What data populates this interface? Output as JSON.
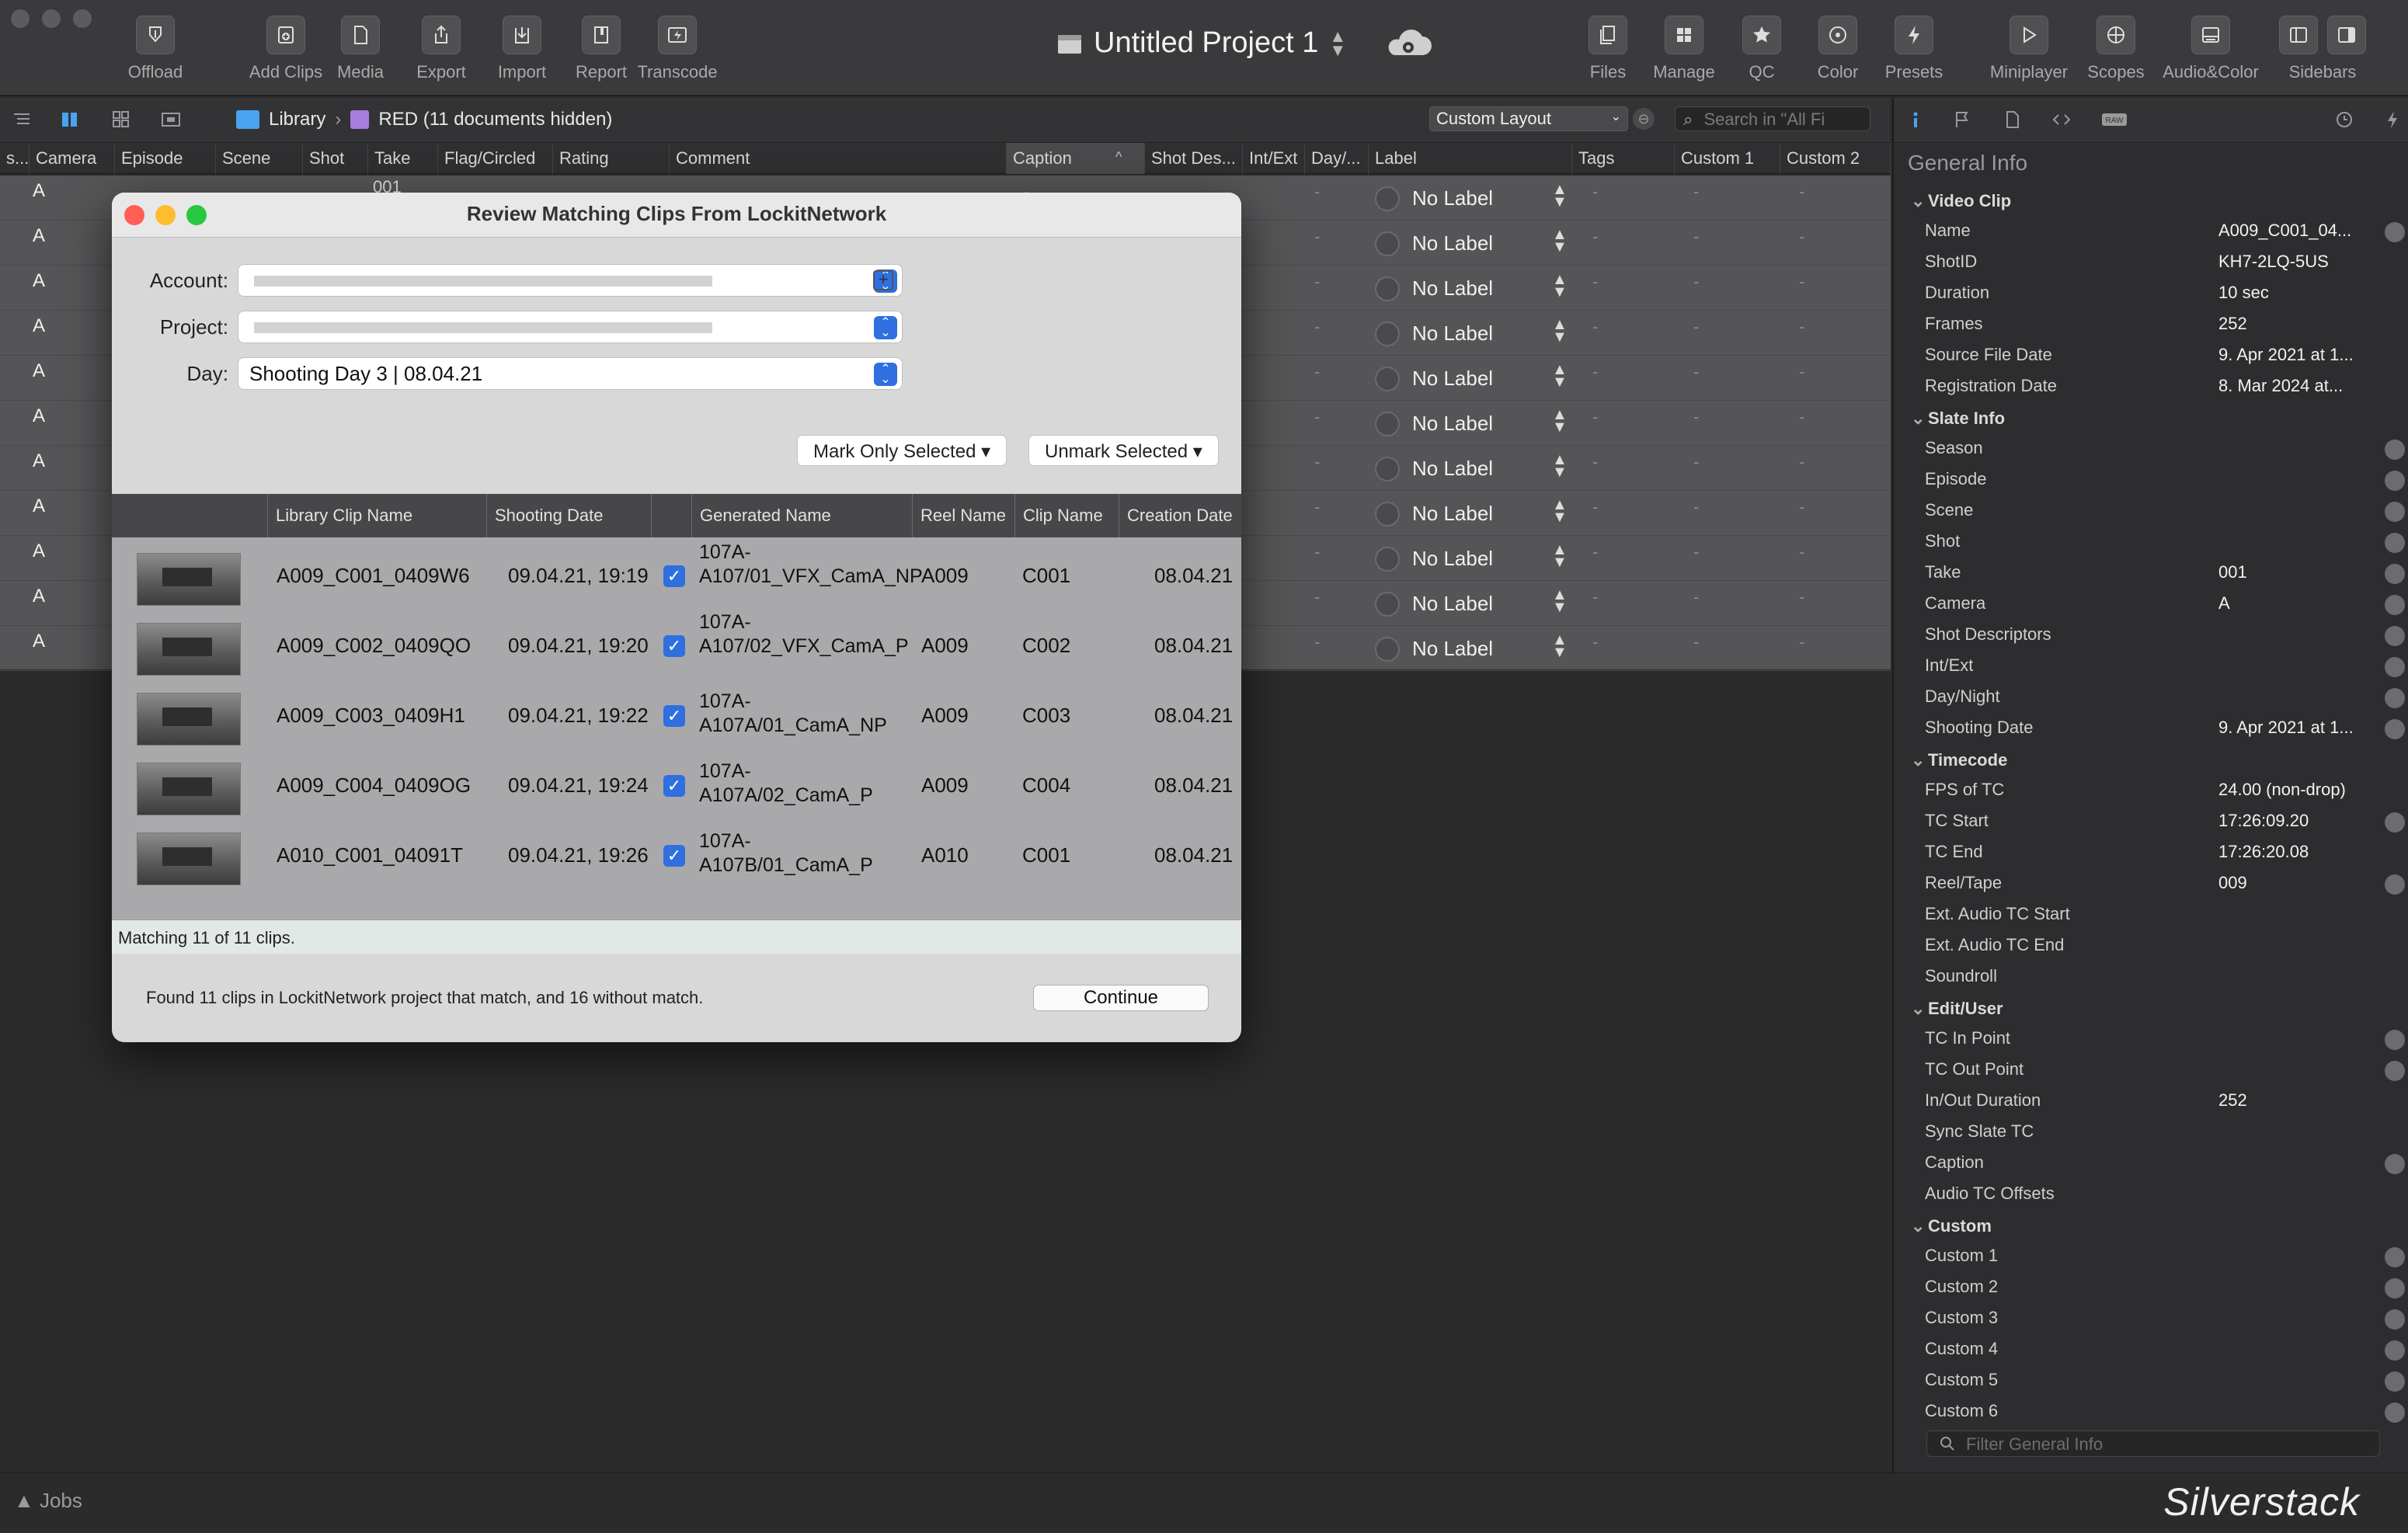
{
  "toolbar": {
    "items": [
      {
        "label": "Offload",
        "icon": "offload-icon"
      },
      {
        "label": "Add Clips",
        "icon": "add-clips-icon"
      },
      {
        "label": "Media",
        "icon": "media-icon"
      },
      {
        "label": "Export",
        "icon": "export-icon"
      },
      {
        "label": "Import",
        "icon": "import-icon"
      },
      {
        "label": "Report",
        "icon": "report-icon"
      },
      {
        "label": "Transcode",
        "icon": "transcode-icon"
      },
      {
        "label": "Files",
        "icon": "files-icon"
      },
      {
        "label": "Manage",
        "icon": "manage-icon"
      },
      {
        "label": "QC",
        "icon": "qc-star-icon"
      },
      {
        "label": "Color",
        "icon": "color-icon"
      },
      {
        "label": "Presets",
        "icon": "presets-bolt-icon"
      },
      {
        "label": "Miniplayer",
        "icon": "miniplayer-icon"
      },
      {
        "label": "Scopes",
        "icon": "scopes-icon"
      },
      {
        "label": "Audio&Color",
        "icon": "audio-color-icon"
      },
      {
        "label": "Sidebars",
        "icon": "sidebars-icon"
      }
    ],
    "project_title": "Untitled Project 1"
  },
  "subbar": {
    "library": "Library",
    "separator": "›",
    "folder": "RED (11 documents hidden)",
    "layout": "Custom Layout",
    "search_placeholder": "Search in \"All Fi"
  },
  "columns": [
    "s...",
    "Camera",
    "Episode",
    "Scene",
    "Shot",
    "Take",
    "Flag/Circled",
    "Rating",
    "Comment",
    "Caption",
    "Shot Des...",
    "Int/Ext",
    "Day/...",
    "Label",
    "Tags",
    "Custom 1",
    "Custom 2"
  ],
  "rows": [
    {
      "camera": "A",
      "take": "001",
      "label": "No Label"
    },
    {
      "camera": "A",
      "label": "No Label"
    },
    {
      "camera": "A",
      "label": "No Label"
    },
    {
      "camera": "A",
      "label": "No Label"
    },
    {
      "camera": "A",
      "label": "No Label"
    },
    {
      "camera": "A",
      "label": "No Label"
    },
    {
      "camera": "A",
      "label": "No Label"
    },
    {
      "camera": "A",
      "label": "No Label"
    },
    {
      "camera": "A",
      "label": "No Label"
    },
    {
      "camera": "A",
      "label": "No Label"
    },
    {
      "camera": "A",
      "label": "No Label"
    }
  ],
  "dialog": {
    "title": "Review Matching Clips From LockitNetwork",
    "account_label": "Account:",
    "project_label": "Project:",
    "day_label": "Day:",
    "day_value": "Shooting Day 3 | 08.04.21",
    "mark_btn": "Mark Only Selected ▾",
    "unmark_btn": "Unmark Selected ▾",
    "headers": [
      "Library Clip Name",
      "Shooting Date",
      "Generated Name",
      "Reel Name",
      "Clip Name",
      "Creation Date"
    ],
    "clips": [
      {
        "library": "A009_C001_0409W6",
        "date": "09.04.21, 19:19",
        "generated": "107A-A107/01_VFX_CamA_NP",
        "reel": "A009",
        "clip": "C001",
        "created": "08.04.21"
      },
      {
        "library": "A009_C002_0409QO",
        "date": "09.04.21, 19:20",
        "generated": "107A-A107/02_VFX_CamA_P",
        "reel": "A009",
        "clip": "C002",
        "created": "08.04.21"
      },
      {
        "library": "A009_C003_0409H1",
        "date": "09.04.21, 19:22",
        "generated": "107A-A107A/01_CamA_NP",
        "reel": "A009",
        "clip": "C003",
        "created": "08.04.21"
      },
      {
        "library": "A009_C004_0409OG",
        "date": "09.04.21, 19:24",
        "generated": "107A-A107A/02_CamA_P",
        "reel": "A009",
        "clip": "C004",
        "created": "08.04.21"
      },
      {
        "library": "A010_C001_04091T",
        "date": "09.04.21, 19:26",
        "generated": "107A-A107B/01_CamA_P",
        "reel": "A010",
        "clip": "C001",
        "created": "08.04.21"
      }
    ],
    "matching": "Matching 11 of 11 clips.",
    "found": "Found 11 clips in LockitNetwork project that match, and 16 without match.",
    "continue": "Continue"
  },
  "inspector": {
    "title": "General Info",
    "sections": [
      {
        "name": "Video Clip",
        "rows": [
          {
            "k": "Name",
            "v": "A009_C001_04...",
            "edit": true
          },
          {
            "k": "ShotID",
            "v": "KH7-2LQ-5US"
          },
          {
            "k": "Duration",
            "v": "10 sec"
          },
          {
            "k": "Frames",
            "v": "252"
          },
          {
            "k": "Source File Date",
            "v": "9. Apr 2021 at 1..."
          },
          {
            "k": "Registration Date",
            "v": "8. Mar 2024 at..."
          }
        ]
      },
      {
        "name": "Slate Info",
        "rows": [
          {
            "k": "Season",
            "v": "",
            "edit": true
          },
          {
            "k": "Episode",
            "v": "",
            "edit": true
          },
          {
            "k": "Scene",
            "v": "",
            "edit": true
          },
          {
            "k": "Shot",
            "v": "",
            "edit": true
          },
          {
            "k": "Take",
            "v": "001",
            "edit": true
          },
          {
            "k": "Camera",
            "v": "A",
            "edit": true
          },
          {
            "k": "Shot Descriptors",
            "v": "",
            "edit": true
          },
          {
            "k": "Int/Ext",
            "v": "",
            "edit": true
          },
          {
            "k": "Day/Night",
            "v": "",
            "edit": true
          },
          {
            "k": "Shooting Date",
            "v": "9. Apr 2021 at 1...",
            "edit": true
          }
        ]
      },
      {
        "name": "Timecode",
        "rows": [
          {
            "k": "FPS of TC",
            "v": "24.00 (non-drop)"
          },
          {
            "k": "TC Start",
            "v": "17:26:09.20",
            "edit": true
          },
          {
            "k": "TC End",
            "v": "17:26:20.08"
          },
          {
            "k": "Reel/Tape",
            "v": "009",
            "edit": true
          },
          {
            "k": "Ext. Audio TC Start",
            "v": ""
          },
          {
            "k": "Ext. Audio TC End",
            "v": ""
          },
          {
            "k": "Soundroll",
            "v": ""
          }
        ]
      },
      {
        "name": "Edit/User",
        "rows": [
          {
            "k": "TC In Point",
            "v": "",
            "edit": true
          },
          {
            "k": "TC Out Point",
            "v": "",
            "edit": true
          },
          {
            "k": "In/Out Duration",
            "v": "252"
          },
          {
            "k": "Sync Slate TC",
            "v": ""
          },
          {
            "k": "Caption",
            "v": "",
            "edit": true
          },
          {
            "k": "Audio TC Offsets",
            "v": ""
          }
        ]
      },
      {
        "name": "Custom",
        "rows": [
          {
            "k": "Custom 1",
            "v": "",
            "edit": true
          },
          {
            "k": "Custom 2",
            "v": "",
            "edit": true
          },
          {
            "k": "Custom 3",
            "v": "",
            "edit": true
          },
          {
            "k": "Custom 4",
            "v": "",
            "edit": true
          },
          {
            "k": "Custom 5",
            "v": "",
            "edit": true
          },
          {
            "k": "Custom 6",
            "v": "",
            "edit": true
          }
        ]
      }
    ],
    "filter_placeholder": "Filter General Info"
  },
  "bottom": {
    "jobs": "▲ Jobs",
    "brand": "Silverstack"
  },
  "colors": {
    "accent": "#2f6fe0",
    "close": "#ff5f57",
    "minimize": "#febc2e",
    "zoom": "#28c840"
  }
}
